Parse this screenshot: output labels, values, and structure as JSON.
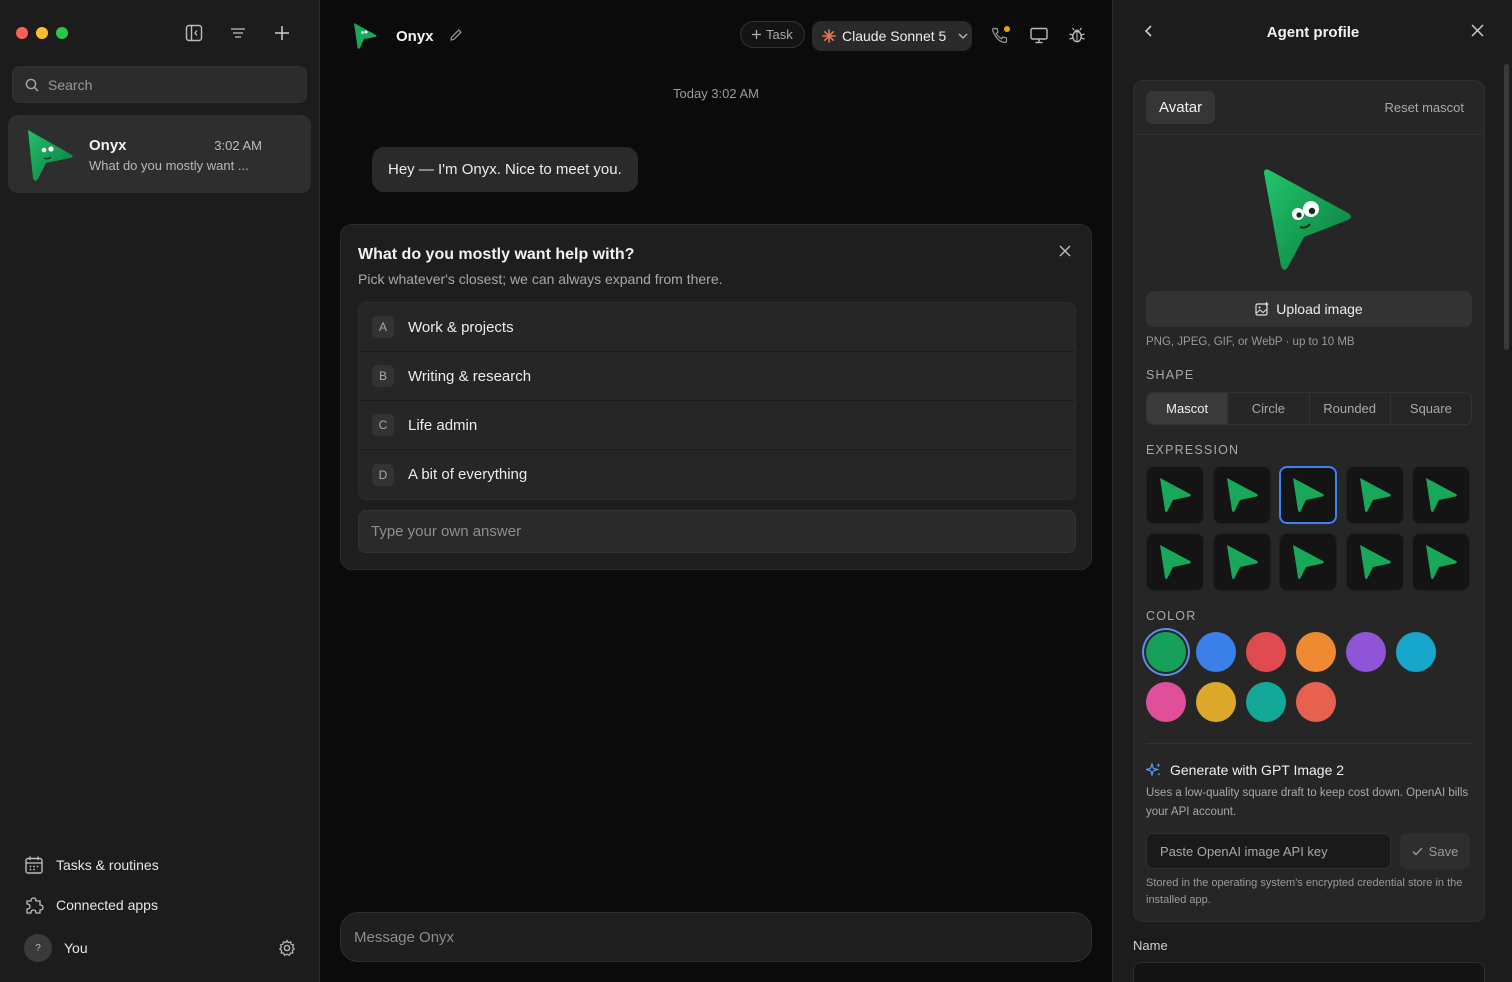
{
  "sidebar": {
    "search_placeholder": "Search",
    "conversation": {
      "name": "Onyx",
      "time": "3:02 AM",
      "preview": "What do you mostly want ..."
    },
    "footer": {
      "tasks": "Tasks & routines",
      "apps": "Connected apps",
      "user": "You",
      "user_initial": "?"
    }
  },
  "chat": {
    "title": "Onyx",
    "task_label": "Task",
    "model": "Claude Sonnet 5",
    "timestamp": "Today 3:02 AM",
    "message": "Hey — I'm Onyx. Nice to meet you.",
    "question": {
      "title": "What do you mostly want help with?",
      "subtitle": "Pick whatever's closest; we can always expand from there.",
      "options": [
        {
          "key": "A",
          "label": "Work & projects"
        },
        {
          "key": "B",
          "label": "Writing & research"
        },
        {
          "key": "C",
          "label": "Life admin"
        },
        {
          "key": "D",
          "label": "A bit of everything"
        }
      ],
      "own_placeholder": "Type your own answer"
    },
    "composer_placeholder": "Message Onyx"
  },
  "panel": {
    "title": "Agent profile",
    "tab": "Avatar",
    "reset": "Reset mascot",
    "upload": "Upload image",
    "upload_hint": "PNG, JPEG, GIF, or WebP · up to 10 MB",
    "shape_label": "SHAPE",
    "shapes": [
      "Mascot",
      "Circle",
      "Rounded",
      "Square"
    ],
    "shape_selected": "Mascot",
    "expression_label": "EXPRESSION",
    "expression_selected_index": 2,
    "color_label": "COLOR",
    "colors": [
      "#16a05a",
      "#3b7fe8",
      "#e04b52",
      "#ed8a32",
      "#8f55d6",
      "#17a6cc",
      "#e0509a",
      "#dca92a",
      "#14a898",
      "#e8604e"
    ],
    "color_selected_index": 0,
    "generate_title": "Generate with GPT Image 2",
    "generate_desc": "Uses a low-quality square draft to keep cost down. OpenAI bills your API account.",
    "api_placeholder": "Paste OpenAI image API key",
    "save": "Save",
    "stored_note": "Stored in the operating system's encrypted credential store in the installed app.",
    "name_label": "Name"
  },
  "theme": {
    "accent": "#16a05a",
    "selection": "#3b82f6",
    "notify": "#f59e0b"
  }
}
